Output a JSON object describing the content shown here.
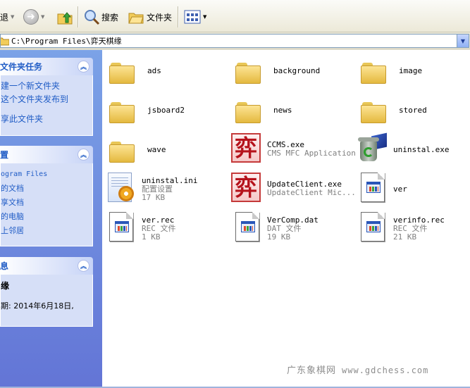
{
  "toolbar": {
    "back_partial": "退",
    "search": "搜索",
    "folders": "文件夹"
  },
  "address": {
    "path": "C:\\Program Files\\弈天棋缘"
  },
  "tasks": {
    "title": "文件夹任务",
    "items": [
      "建一个新文件夹",
      "这个文件夹发布到",
      "享此文件夹"
    ]
  },
  "places": {
    "title": "置",
    "items": [
      "ogram Files",
      "的文档",
      "享文档",
      "的电脑",
      "上邻居"
    ]
  },
  "details": {
    "title": "息",
    "name": "缘",
    "date": "期: 2014年6月18日,"
  },
  "files": [
    {
      "name": "ads",
      "kind": "folder"
    },
    {
      "name": "background",
      "kind": "folder"
    },
    {
      "name": "image",
      "kind": "folder"
    },
    {
      "name": "jsboard2",
      "kind": "folder"
    },
    {
      "name": "news",
      "kind": "folder"
    },
    {
      "name": "stored",
      "kind": "folder"
    },
    {
      "name": "wave",
      "kind": "folder"
    },
    {
      "name": "CCMS.exe",
      "line2": "CMS MFC Application",
      "kind": "app-ccms"
    },
    {
      "name": "uninstal.exe",
      "kind": "uninstaller"
    },
    {
      "name": "uninstal.ini",
      "line2": "配置设置",
      "line3": "17 KB",
      "kind": "ini"
    },
    {
      "name": "UpdateClient.exe",
      "line2": "UpdateClient Mic...",
      "kind": "app-ccms"
    },
    {
      "name": "ver",
      "kind": "doc"
    },
    {
      "name": "ver.rec",
      "line2": "REC 文件",
      "line3": "1 KB",
      "kind": "doc"
    },
    {
      "name": "VerComp.dat",
      "line2": "DAT 文件",
      "line3": "19 KB",
      "kind": "doc"
    },
    {
      "name": "verinfo.rec",
      "line2": "REC 文件",
      "line3": "21 KB",
      "kind": "doc"
    }
  ],
  "ccms_glyph": "弈",
  "watermark": {
    "text": "广东象棋网",
    "url": "www.gdchess.com"
  },
  "colors": {
    "task_link": "#215dc6",
    "pane_top": "#7ba2e7",
    "pane_bottom": "#6375d6"
  }
}
